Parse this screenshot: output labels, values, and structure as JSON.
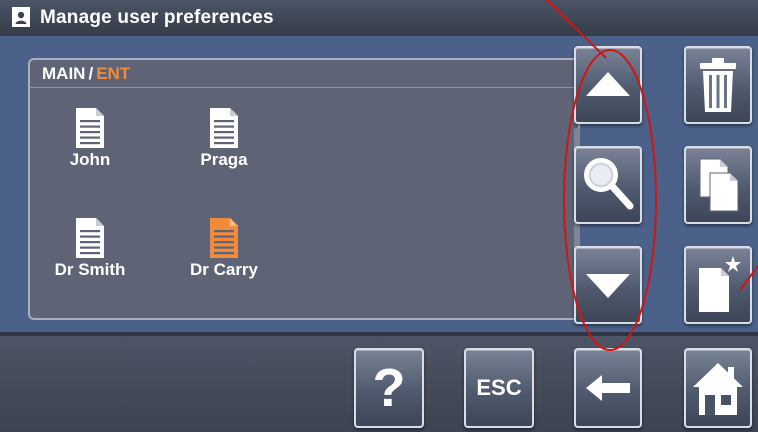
{
  "title": "Manage user preferences",
  "breadcrumb": {
    "root": "MAIN",
    "separator": "/",
    "current": "ENT"
  },
  "files": [
    {
      "name": "John",
      "highlighted": false
    },
    {
      "name": "Praga",
      "highlighted": false
    },
    {
      "name": "Dr Smith",
      "highlighted": false
    },
    {
      "name": "Dr Carry",
      "highlighted": true
    }
  ],
  "buttons": {
    "scroll_up": "up-arrow-icon",
    "search": "magnifier-icon",
    "scroll_down": "down-arrow-icon",
    "delete": "trash-icon",
    "copy": "copy-icon",
    "new": "new-document-icon",
    "help": "?",
    "escape": "ESC",
    "back": "left-arrow-icon",
    "home": "home-icon"
  },
  "colors": {
    "accent": "#f28a3c",
    "annotation": "#d11515",
    "panel": "#4b6189"
  }
}
